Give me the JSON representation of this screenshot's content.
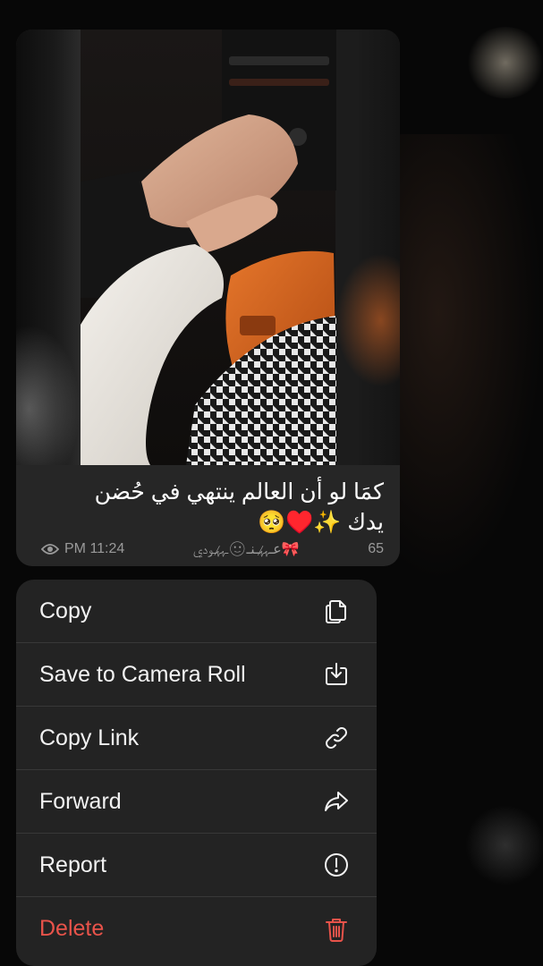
{
  "message": {
    "caption_line1": "كمَا لو أن العالم ينتهي في حُضن",
    "caption_line2": "يدك ✨♥️🥺",
    "views": "65",
    "author_signature": "🎀عـﮩ̷̷ﮩـنـ🙂︎ـﮩ̷̷ﮩـودي",
    "time": "PM 11:24"
  },
  "menu": {
    "items": [
      {
        "label": "Copy",
        "icon": "copy-icon"
      },
      {
        "label": "Save to Camera Roll",
        "icon": "download-icon"
      },
      {
        "label": "Copy Link",
        "icon": "link-icon"
      },
      {
        "label": "Forward",
        "icon": "forward-icon"
      },
      {
        "label": "Report",
        "icon": "exclamation-icon"
      },
      {
        "label": "Delete",
        "icon": "trash-icon"
      }
    ]
  },
  "colors": {
    "background": "#070707",
    "bubble": "#262626",
    "menu": "#232323",
    "danger": "#e8534a"
  }
}
